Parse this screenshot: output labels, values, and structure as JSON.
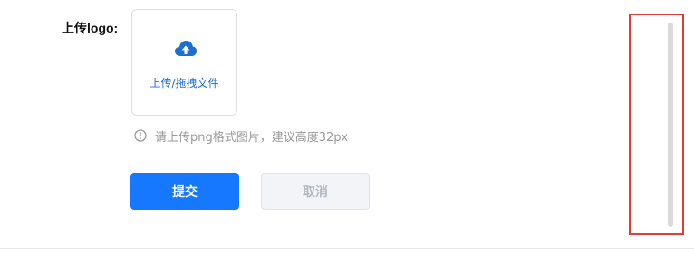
{
  "form": {
    "logo_label": "上传logo:",
    "upload": {
      "icon": "cloud-upload-icon",
      "text": "上传/拖拽文件"
    },
    "hint": {
      "icon": "info-circle-icon",
      "text": "请上传png格式图片，建议高度32px"
    },
    "submit_label": "提交",
    "cancel_label": "取消"
  },
  "colors": {
    "primary": "#1677ff",
    "upload_text": "#1b6fd1",
    "highlight_border": "#e23b3b",
    "scrollbar_thumb": "#d9d9d9"
  }
}
